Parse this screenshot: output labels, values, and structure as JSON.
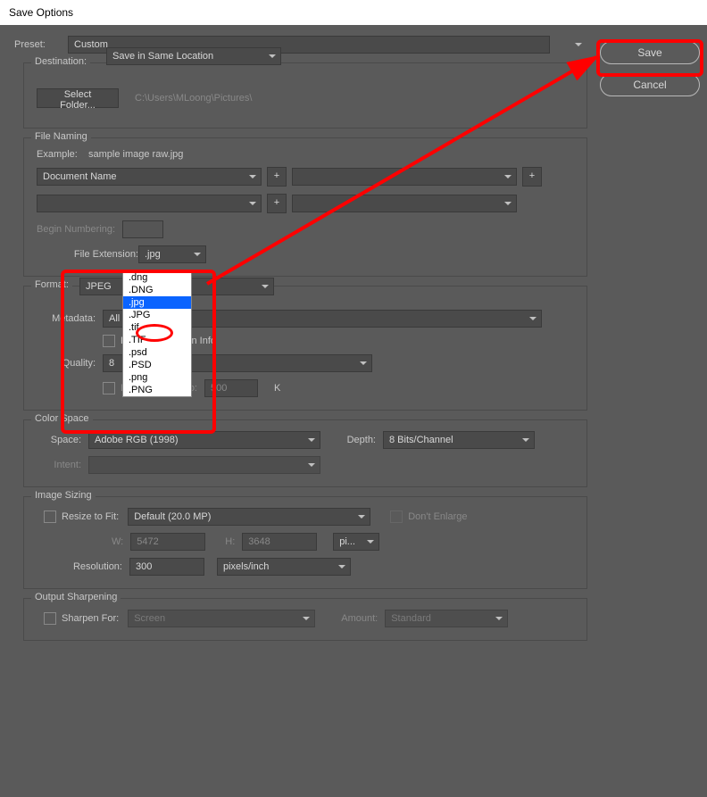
{
  "title": "Save Options",
  "preset": {
    "label": "Preset:",
    "value": "Custom"
  },
  "buttons": {
    "save": "Save",
    "cancel": "Cancel"
  },
  "destination": {
    "legend": "Destination:",
    "value": "Save in Same Location",
    "select_folder": "Select Folder...",
    "path": "C:\\Users\\MLoong\\Pictures\\"
  },
  "file_naming": {
    "legend": "File Naming",
    "example_label": "Example:",
    "example_value": "sample image raw.jpg",
    "field1": "Document Name",
    "plus": "+",
    "begin_num_label": "Begin Numbering:",
    "ext_label": "File Extension:",
    "ext_value": ".jpg",
    "ext_options": [
      ".dng",
      ".DNG",
      ".jpg",
      ".JPG",
      ".tif",
      ".TIF",
      ".psd",
      ".PSD",
      ".png",
      ".PNG"
    ]
  },
  "format": {
    "legend": "Format:",
    "value": "JPEG",
    "metadata_label": "Metadata:",
    "metadata_value": "All",
    "remove_loc": "Remove Location Info",
    "quality_label": "Quality:",
    "quality_value": "8",
    "limit_label": "Limit File Size To:",
    "limit_value": "500",
    "limit_unit": "K"
  },
  "color_space": {
    "legend": "Color Space",
    "space_label": "Space:",
    "space_value": "Adobe RGB (1998)",
    "depth_label": "Depth:",
    "depth_value": "8 Bits/Channel",
    "intent_label": "Intent:"
  },
  "image_sizing": {
    "legend": "Image Sizing",
    "resize_label": "Resize to Fit:",
    "resize_value": "Default  (20.0 MP)",
    "dont_enlarge": "Don't Enlarge",
    "w_label": "W:",
    "w_value": "5472",
    "h_label": "H:",
    "h_value": "3648",
    "unit": "pi...",
    "res_label": "Resolution:",
    "res_value": "300",
    "res_unit": "pixels/inch"
  },
  "sharpening": {
    "legend": "Output Sharpening",
    "sharpen_label": "Sharpen For:",
    "sharpen_value": "Screen",
    "amount_label": "Amount:",
    "amount_value": "Standard"
  }
}
